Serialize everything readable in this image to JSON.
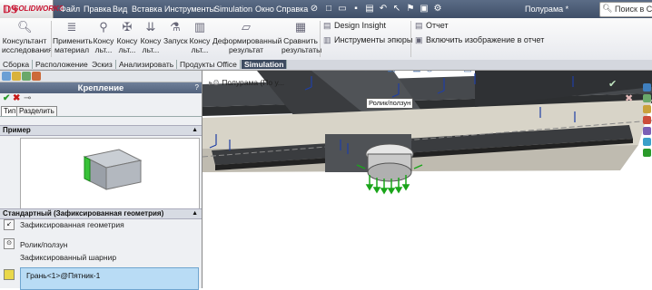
{
  "app": {
    "logo_text": "SOLIDWORKS",
    "document_title": "Полурама *"
  },
  "menu": [
    "Файл",
    "Правка",
    "Вид",
    "Вставка",
    "Инструменты",
    "Simulation",
    "Окно",
    "Справка"
  ],
  "search": {
    "placeholder": "Поиск в Спра"
  },
  "ribbon": {
    "advisor": "Консультант\nисследования",
    "apply_material": "Применить\nматериал",
    "konsu1": "Консу\nльт...",
    "konsu2": "Консу\nльт...",
    "konsu3": "Консу\nльт...",
    "run": "Запуск",
    "konsu4": "Консу\nльт...",
    "deformed": "Деформированный\nрезультат",
    "compare": "Сравнить\nрезультаты",
    "design_insight": "Design Insight",
    "plot_tools": "Инструменты эпюры",
    "report": "Отчет",
    "include_image": "Включить изображение в отчет"
  },
  "tabs": [
    "Сборка",
    "Расположение",
    "Эскиз",
    "Анализировать",
    "Продукты Office",
    "Simulation"
  ],
  "active_tab": "Simulation",
  "panel": {
    "title": "Крепление",
    "help": "?",
    "subtabs": [
      "Тип",
      "Разделить"
    ],
    "example_section": "Пример",
    "standard_section": "Стандартный (Зафиксированная геометрия)",
    "options": [
      {
        "icon": "fixed-geometry-icon",
        "label": "Зафиксированная геометрия"
      },
      {
        "icon": "roller-slider-icon",
        "label": "Ролик/ползун"
      },
      {
        "icon": "fixed-hinge-icon",
        "label": "Зафиксированный шарнир"
      }
    ],
    "selection": "Грань<1>@Пятник-1"
  },
  "viewport": {
    "tree_label": "Полурама",
    "tree_suffix": "(По у...",
    "tooltip": "Ролик/ползун"
  },
  "colors": {
    "menubar": "#4b5a73",
    "panel_header": "#5f6f8a",
    "active_tab": "#3d4b60",
    "selection_field": "#b9dcf5",
    "fixture_arrows": "#1aa51a",
    "constraint_arrows": "#1f3fa5"
  }
}
